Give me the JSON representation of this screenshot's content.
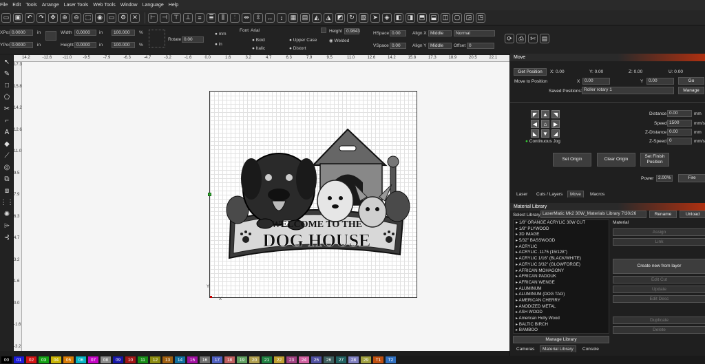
{
  "menu": [
    "File",
    "Edit",
    "Tools",
    "Arrange",
    "Laser Tools",
    "Web Tools",
    "Window",
    "Language",
    "Help"
  ],
  "props": {
    "xpos_label": "XPos",
    "xpos": "0.0000",
    "ypos_label": "YPos",
    "ypos": "0.0000",
    "unit": "in",
    "width_label": "Width",
    "width": "0.0000",
    "height_label": "Height",
    "height": "0.0000",
    "pct1": "100.000",
    "pct2": "100.000",
    "pct_sign": "%",
    "rotate_label": "Rotate",
    "rotate": "0.00",
    "mm": "mm",
    "in": "in",
    "font_label": "Font",
    "font": "Arial",
    "bold": "Bold",
    "italic": "Italic",
    "upper": "Upper Case",
    "distort": "Distort",
    "welded": "Welded",
    "height2_label": "Height",
    "height2": "0.9843",
    "hspace_label": "HSpace",
    "hspace": "0.00",
    "vspace_label": "VSpace",
    "vspace": "0.00",
    "alignx_label": "Align X",
    "alignx": "Middle",
    "aligny_label": "Align Y",
    "aligny": "Middle",
    "normal": "Normal",
    "offset_label": "Offset",
    "offset": "0"
  },
  "ruler": {
    "top": [
      "14.2",
      "-12.6",
      "-11.0",
      "-9.5",
      "-7.9",
      "-6.3",
      "-4.7",
      "-3.2",
      "-1.6",
      "0.0",
      "1.6",
      "3.2",
      "4.7",
      "6.3",
      "7.9",
      "9.5",
      "11.0",
      "12.6",
      "14.2",
      "15.8",
      "17.3",
      "18.9",
      "20.5",
      "22.1"
    ],
    "left": [
      "17.3",
      "15.8",
      "14.2",
      "12.6",
      "11.0",
      "9.5",
      "7.9",
      "6.3",
      "4.7",
      "3.2",
      "1.6",
      "0.0",
      "-1.6",
      "-3.2"
    ]
  },
  "axes": {
    "x": "X",
    "y": "Y"
  },
  "artwork": {
    "line1": "WELCOME TO THE",
    "line2": "DOG HOUSE"
  },
  "move": {
    "title": "Move",
    "get_position": "Get Position",
    "x_label": "X: 0.00",
    "y_label": "Y: 0.00",
    "z_label": "Z: 0.00",
    "u_label": "U: 0.00",
    "move_to": "Move to Position",
    "x": "X",
    "xval": "0.00",
    "y": "Y",
    "yval": "0.00",
    "go": "Go",
    "saved_label": "Saved Positions:",
    "saved": "Roller rotary 1",
    "manage": "Manage",
    "distance_label": "Distance",
    "distance": "0.00",
    "speed_label": "Speed",
    "speed": "1500",
    "zdist_label": "Z-Distance",
    "zdist": "0.00",
    "zspeed_label": "Z-Speed",
    "zspeed": "0",
    "mm": "mm",
    "mms": "mm/s",
    "continuous": "Continuous Jog",
    "set_origin": "Set Origin",
    "clear_origin": "Clear Origin",
    "set_finish": "Set Finish Position",
    "power_label": "Power",
    "power": "2.00%",
    "fire": "Fire"
  },
  "tabs1": [
    "Laser",
    "Cuts / Layers",
    "Move",
    "Macros"
  ],
  "matlib": {
    "title": "Material Library",
    "select_label": "Select Library",
    "library": "LaserMatic Mk2 30W_Materials Library 7/30/26",
    "rename": "Rename",
    "unload": "Unload",
    "material": "Material",
    "items": [
      "1/8\" ORANGE ACRYLIC 30W CUT",
      "1/8\" PLYWOOD",
      "3D IMAGE",
      "5/32\" BASSWOOD",
      "ACRYLIC",
      "ACRYLIC .1175 (15/128\")",
      "ACRYLIC 1/16\" (BLACK/WHITE)",
      "ACRYLIC 3/32\" (GLOWFORGE)",
      "AFRICAN MOHAGONY",
      "AFRICAN PADOUK",
      "AFRICAN WENGE",
      "ALUMINUM",
      "ALUMINUM (DOG TAG)",
      "AMERICAN CHERRY",
      "ANODIZED METAL",
      "ASH WOOD",
      "American Holly Wood",
      "BALTIC BIRCH",
      "BAMBOO"
    ],
    "assign": "Assign",
    "link": "Link",
    "create": "Create new from layer",
    "edit_cut": "Edit Cut",
    "update": "Update",
    "edit_desc": "Edit Desc",
    "duplicate": "Duplicate",
    "delete": "Delete",
    "manage": "Manage Library"
  },
  "tabs2": [
    "Cameras",
    "Material Library",
    "Console"
  ],
  "palette": [
    {
      "n": "00",
      "c": "#000000"
    },
    {
      "n": "01",
      "c": "#1b1bd6"
    },
    {
      "n": "02",
      "c": "#d21414"
    },
    {
      "n": "03",
      "c": "#13a113"
    },
    {
      "n": "04",
      "c": "#c9b406"
    },
    {
      "n": "05",
      "c": "#d97c06"
    },
    {
      "n": "06",
      "c": "#06b4c4"
    },
    {
      "n": "07",
      "c": "#c406c4"
    },
    {
      "n": "08",
      "c": "#8c8c8c"
    },
    {
      "n": "09",
      "c": "#1616a8"
    },
    {
      "n": "10",
      "c": "#a01616"
    },
    {
      "n": "11",
      "c": "#168c16"
    },
    {
      "n": "12",
      "c": "#8c8c10"
    },
    {
      "n": "13",
      "c": "#a06010"
    },
    {
      "n": "14",
      "c": "#1070a0"
    },
    {
      "n": "15",
      "c": "#a010a0"
    },
    {
      "n": "16",
      "c": "#707070"
    },
    {
      "n": "17",
      "c": "#5060c0"
    },
    {
      "n": "18",
      "c": "#c06060"
    },
    {
      "n": "19",
      "c": "#60a060"
    },
    {
      "n": "20",
      "c": "#b0a050"
    },
    {
      "n": "21",
      "c": "#208040"
    },
    {
      "n": "22",
      "c": "#c0a030"
    },
    {
      "n": "23",
      "c": "#a04080"
    },
    {
      "n": "24",
      "c": "#d060a0"
    },
    {
      "n": "25",
      "c": "#5050a0"
    },
    {
      "n": "26",
      "c": "#406060"
    },
    {
      "n": "27",
      "c": "#206060"
    },
    {
      "n": "28",
      "c": "#8080c0"
    },
    {
      "n": "29",
      "c": "#a0a040"
    },
    {
      "n": "T1",
      "c": "#c05010"
    },
    {
      "n": "T2",
      "c": "#3070c0"
    }
  ]
}
